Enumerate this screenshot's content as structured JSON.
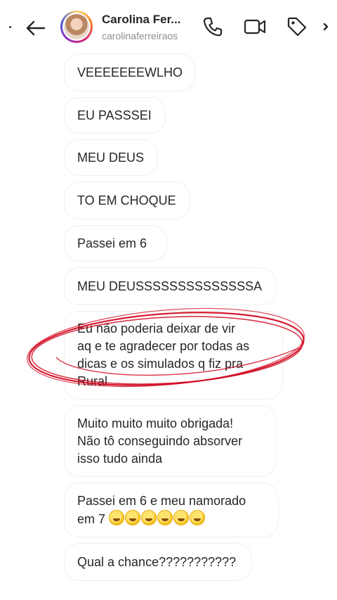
{
  "header": {
    "name": "Carolina Fer...",
    "username": "carolinaferreiraos"
  },
  "icons": {
    "back": "arrow-left-icon",
    "call": "phone-icon",
    "video": "video-camera-icon",
    "tag": "tag-icon",
    "more": "chevron-right-icon"
  },
  "messages": [
    {
      "text": "VEEEEEEEWLHO"
    },
    {
      "text": "EU PASSSEI"
    },
    {
      "text": "MEU DEUS"
    },
    {
      "text": "TO EM CHOQUE"
    },
    {
      "text": "Passei em 6"
    },
    {
      "text": "MEU DEUSSSSSSSSSSSSSSA"
    },
    {
      "text": "Eu não poderia deixar de vir\naq e te agradecer por todas as\ndicas e os simulados q fiz pra\nRural"
    },
    {
      "text": "Muito muito muito obrigada!\nNão tô conseguindo absorver\nisso tudo ainda"
    },
    {
      "text": "Passei em 6 e meu namorado\nem 7 ",
      "emoji_count": 6,
      "emoji": "rolling-on-the-floor-laughing"
    },
    {
      "text": "Qual a chance???????????"
    }
  ],
  "annotation": {
    "color": "#d0021b"
  }
}
